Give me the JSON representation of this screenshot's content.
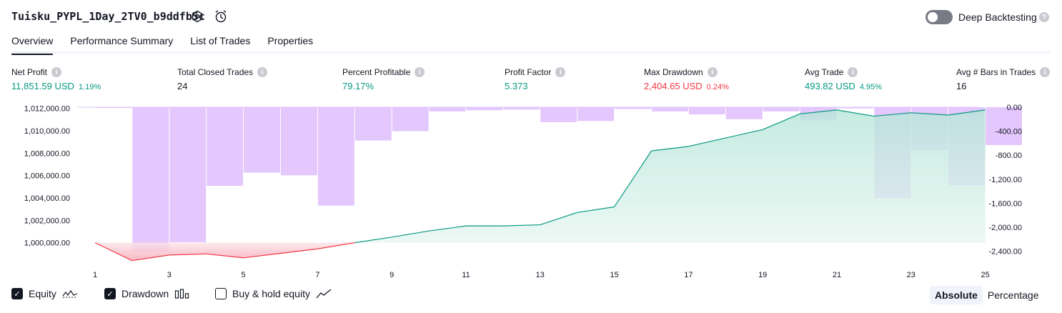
{
  "header": {
    "title": "Tuisku_PYPL_1Day_2TV0_b9ddfb5c",
    "settings_icon": "gear-icon",
    "replay_icon": "alarm-refresh-icon",
    "deep_backtesting_label": "Deep Backtesting",
    "deep_backtesting_on": false
  },
  "tabs": [
    {
      "label": "Overview",
      "active": true
    },
    {
      "label": "Performance Summary",
      "active": false
    },
    {
      "label": "List of Trades",
      "active": false
    },
    {
      "label": "Properties",
      "active": false
    }
  ],
  "metrics": [
    {
      "label": "Net Profit",
      "value": "11,851.59 USD",
      "sub": "1.19%",
      "color": "green"
    },
    {
      "label": "Total Closed Trades",
      "value": "24",
      "sub": "",
      "color": "dark"
    },
    {
      "label": "Percent Profitable",
      "value": "79.17%",
      "sub": "",
      "color": "green"
    },
    {
      "label": "Profit Factor",
      "value": "5.373",
      "sub": "",
      "color": "green"
    },
    {
      "label": "Max Drawdown",
      "value": "2,404.65 USD",
      "sub": "0.24%",
      "color": "red"
    },
    {
      "label": "Avg Trade",
      "value": "493.82 USD",
      "sub": "4.95%",
      "color": "green"
    },
    {
      "label": "Avg # Bars in Trades",
      "value": "16",
      "sub": "",
      "color": "dark"
    }
  ],
  "legend": {
    "equity_label": "Equity",
    "drawdown_label": "Drawdown",
    "buy_hold_label": "Buy & hold equity",
    "equity_checked": true,
    "drawdown_checked": true,
    "buy_hold_checked": false
  },
  "view_toggle": {
    "absolute_label": "Absolute",
    "percentage_label": "Percentage",
    "selected": "Absolute"
  },
  "colors": {
    "green": "#089981",
    "red": "#f23645",
    "drawdown_bar": "#e1c4fd",
    "equity_area": "#ccefe6"
  },
  "chart_data": {
    "type": "area",
    "x_ticks": [
      "1",
      "3",
      "5",
      "7",
      "9",
      "11",
      "13",
      "15",
      "17",
      "19",
      "21",
      "23",
      "25"
    ],
    "left_axis_ticks": [
      "1,012,000.00",
      "1,010,000.00",
      "1,008,000.00",
      "1,006,000.00",
      "1,004,000.00",
      "1,002,000.00",
      "1,000,000.00"
    ],
    "right_axis_ticks": [
      "0.00",
      "-400.00",
      "-800.00",
      "-1,200.00",
      "-1,600.00",
      "-2,000.00",
      "-2,400.00"
    ],
    "left_ylim": [
      998700,
      1012100
    ],
    "right_ylim": [
      -2500,
      0
    ],
    "initial_capital": 1000000,
    "series": [
      {
        "name": "Equity",
        "x": [
          1,
          2,
          3,
          4,
          5,
          6,
          7,
          8,
          9,
          10,
          11,
          12,
          13,
          14,
          15,
          16,
          17,
          18,
          19,
          20,
          21,
          22,
          23,
          24,
          25
        ],
        "values": [
          1000000,
          998400,
          998900,
          999000,
          998650,
          999050,
          999450,
          1000000,
          1000500,
          1001050,
          1001500,
          1001500,
          1001600,
          1002700,
          1003200,
          1008200,
          1008600,
          1009350,
          1010100,
          1011500,
          1011851,
          1011300,
          1011600,
          1011400,
          1011851
        ]
      },
      {
        "name": "Drawdown",
        "x": [
          1,
          2,
          3,
          4,
          5,
          6,
          7,
          8,
          9,
          10,
          11,
          12,
          13,
          14,
          15,
          16,
          17,
          18,
          19,
          20,
          21,
          22,
          23,
          24,
          25
        ],
        "values": [
          -2,
          -2404,
          -2250,
          -1310,
          -1090,
          -1135,
          -1640,
          -555,
          -400,
          -70,
          -50,
          -40,
          -250,
          -230,
          -30,
          -70,
          -120,
          -200,
          -70,
          -210,
          -20,
          -1520,
          -720,
          -1300,
          -630
        ]
      }
    ],
    "grid": false
  }
}
